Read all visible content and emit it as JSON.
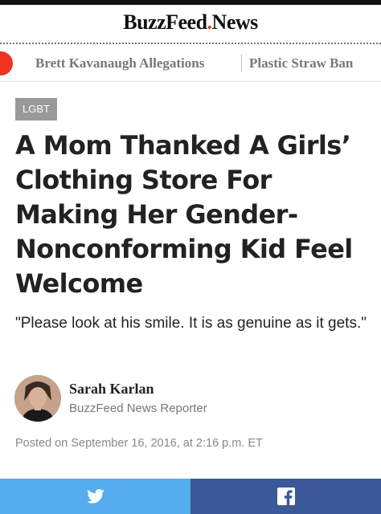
{
  "header": {
    "logo_buzz": "BuzzFeed",
    "logo_dot": ".",
    "logo_news": "News"
  },
  "nav": {
    "items": [
      {
        "label": "Brett Kavanaugh Allegations"
      },
      {
        "label": "Plastic Straw Ban"
      }
    ]
  },
  "article": {
    "tag": "LGBT",
    "title": "A Mom Thanked A Girls’ Clothing Store For Making Her Gender-Nonconforming Kid Feel Welcome",
    "dek": "\"Please look at his smile. It is as genuine as it gets.\"",
    "author_name": "Sarah Karlan",
    "author_role": "BuzzFeed News Reporter",
    "posted": "Posted on September 16, 2016, at 2:16 p.m. ET"
  },
  "share": {
    "twitter_icon": "twitter-icon",
    "facebook_icon": "facebook-icon",
    "twitter_color": "#55acee",
    "facebook_color": "#3b5998"
  },
  "colors": {
    "accent": "#ee3322",
    "tag_bg": "#999999"
  }
}
